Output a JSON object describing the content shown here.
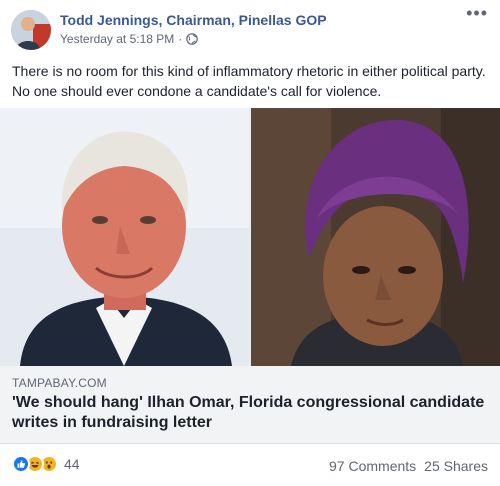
{
  "post": {
    "author": "Todd Jennings, Chairman, Pinellas GOP",
    "timestamp": "Yesterday at 5:18 PM",
    "separator": "·",
    "audience_icon": "globe-icon",
    "more_icon": "more-options-icon",
    "text": "There is no room for this kind of inflammatory rhetoric in either political party. No one should ever condone a candidate's call for violence."
  },
  "link_preview": {
    "domain": "TAMPABAY.COM",
    "title": "'We should hang' Ilhan Omar, Florida congressional candidate writes in fundraising letter"
  },
  "engagement": {
    "reaction_icons": [
      "like-icon",
      "haha-icon",
      "wow-icon"
    ],
    "reaction_count": "44",
    "comments": "97 Comments",
    "shares": "25 Shares"
  },
  "colors": {
    "author_link": "#385898",
    "secondary_text": "#606770",
    "link_box_bg": "#f2f3f5",
    "like_blue": "#1877f2",
    "reaction_yellow": "#f7b125"
  }
}
